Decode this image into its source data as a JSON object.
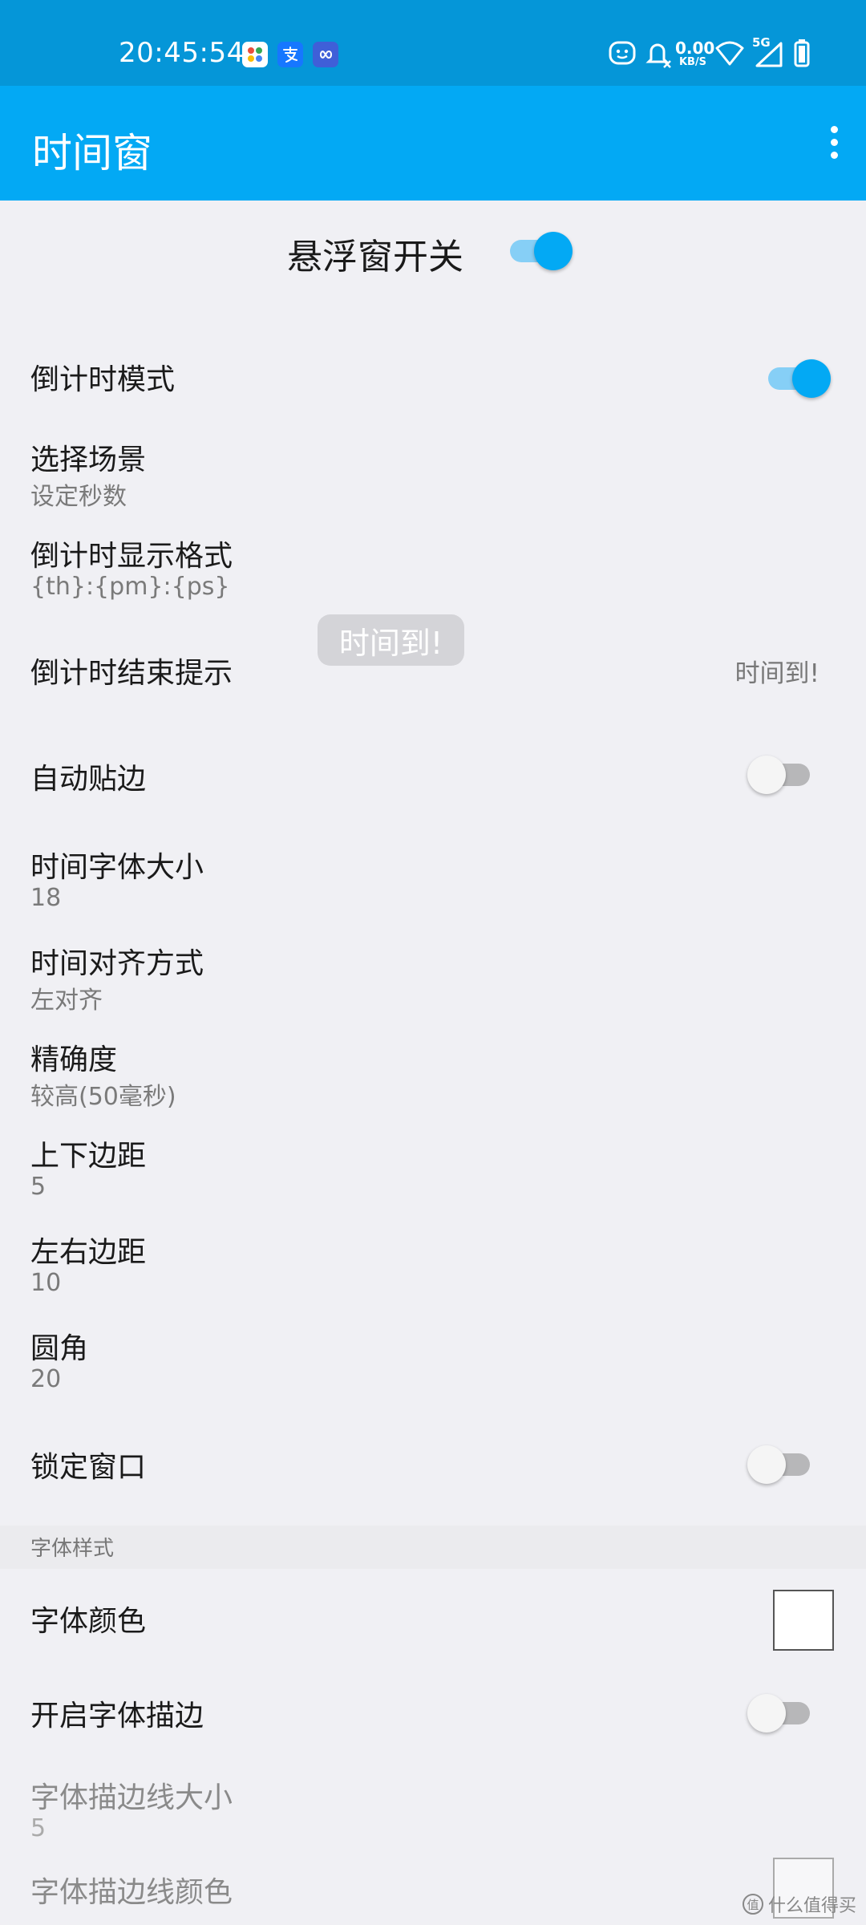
{
  "status_bar": {
    "time": "20:45:54",
    "net_speed_value": "0.00",
    "net_speed_unit": "KB/S",
    "network": "5G",
    "app_icons": [
      "app-icon-multicolor",
      "alipay-icon",
      "infinity-app-icon"
    ]
  },
  "app_bar": {
    "title": "时间窗"
  },
  "master_switch": {
    "label": "悬浮窗开关",
    "on": true
  },
  "prefs": {
    "countdown_mode": {
      "title": "倒计时模式",
      "on": true
    },
    "select_scene": {
      "title": "选择场景",
      "summary": "设定秒数"
    },
    "countdown_format": {
      "title": "倒计时显示格式",
      "summary": "{th}:{pm}:{ps}"
    },
    "countdown_end_tip": {
      "title": "倒计时结束提示",
      "value": "时间到!"
    },
    "auto_edge": {
      "title": "自动贴边",
      "on": false
    },
    "font_size": {
      "title": "时间字体大小",
      "summary": "18"
    },
    "alignment": {
      "title": "时间对齐方式",
      "summary": "左对齐"
    },
    "precision": {
      "title": "精确度",
      "summary": "较高(50毫秒)"
    },
    "vertical_padding": {
      "title": "上下边距",
      "summary": "5"
    },
    "horizontal_padding": {
      "title": "左右边距",
      "summary": "10"
    },
    "corner_radius": {
      "title": "圆角",
      "summary": "20"
    },
    "lock_window": {
      "title": "锁定窗口",
      "on": false
    }
  },
  "font_section": {
    "header": "字体样式",
    "font_color": {
      "title": "字体颜色",
      "color": "#ffffff"
    },
    "stroke_enabled": {
      "title": "开启字体描边",
      "on": false
    },
    "stroke_size": {
      "title": "字体描边线大小",
      "summary": "5"
    },
    "stroke_color": {
      "title": "字体描边线颜色"
    }
  },
  "toast": {
    "text": "时间到!"
  },
  "watermark": {
    "text": "什么值得买",
    "logo": "值"
  },
  "colors": {
    "status_bar": "#0596d8",
    "app_bar": "#03a9f4",
    "accent": "#03a9f4",
    "background": "#f0f0f4"
  }
}
